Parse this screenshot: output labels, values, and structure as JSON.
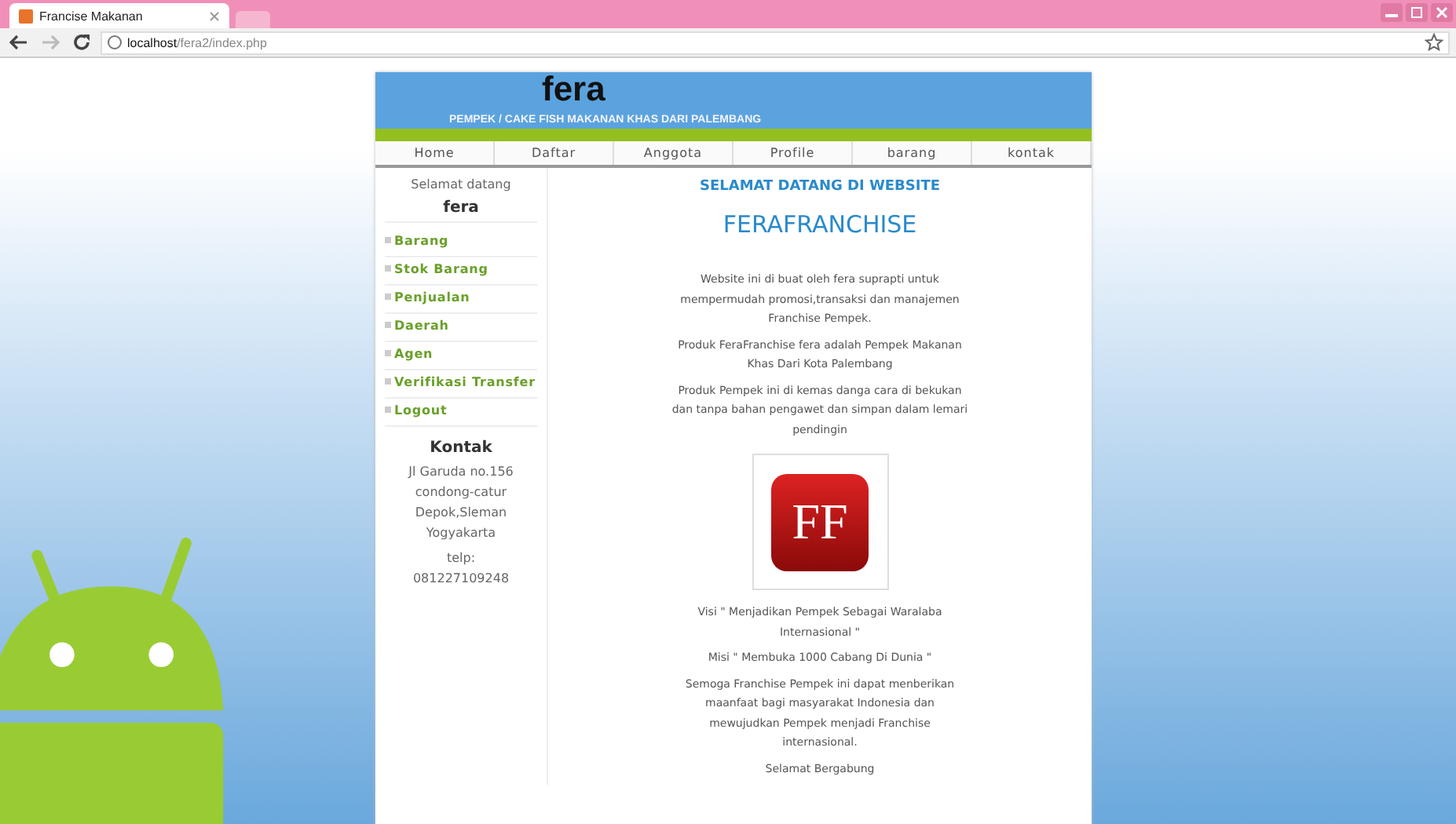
{
  "browser": {
    "tab_title": "Francise Makanan",
    "url_host": "localhost",
    "url_path": "/fera2/index.php"
  },
  "header": {
    "logo": "fera",
    "tagline": "PEMPEK / CAKE FISH MAKANAN KHAS DARI PALEMBANG"
  },
  "nav": [
    "Home",
    "Daftar",
    "Anggota",
    "Profile",
    "barang",
    "kontak"
  ],
  "sidebar": {
    "greeting": "Selamat datang",
    "user": "fera",
    "menu": [
      "Barang",
      "Stok Barang",
      "Penjualan",
      "Daerah",
      "Agen",
      "Verifikasi Transfer",
      "Logout"
    ],
    "contact_title": "Kontak",
    "address": [
      "Jl Garuda no.156",
      "condong-catur",
      "Depok,Sleman",
      "Yogyakarta"
    ],
    "phone_label": "telp:",
    "phone": "081227109248"
  },
  "content": {
    "subtitle": "SELAMAT DATANG DI WEBSITE",
    "title": "FERAFRANCHISE",
    "intro": [
      "Website ini di buat oleh fera suprapti untuk mempermudah promosi,transaksi dan manajemen Franchise Pempek.",
      "Produk FeraFranchise fera adalah Pempek Makanan Khas Dari Kota Palembang",
      "Produk Pempek ini di kemas danga cara di bekukan dan tanpa bahan pengawet dan simpan dalam lemari pendingin"
    ],
    "logo_letters": "FF",
    "outro": [
      "Visi \" Menjadikan Pempek Sebagai Waralaba Internasional \"",
      "Misi \" Membuka 1000 Cabang Di Dunia \"",
      "Semoga Franchise Pempek ini dapat menberikan maanfaat bagi masyarakat Indonesia dan mewujudkan Pempek menjadi Franchise internasional.",
      "Selamat Bergabung"
    ]
  }
}
